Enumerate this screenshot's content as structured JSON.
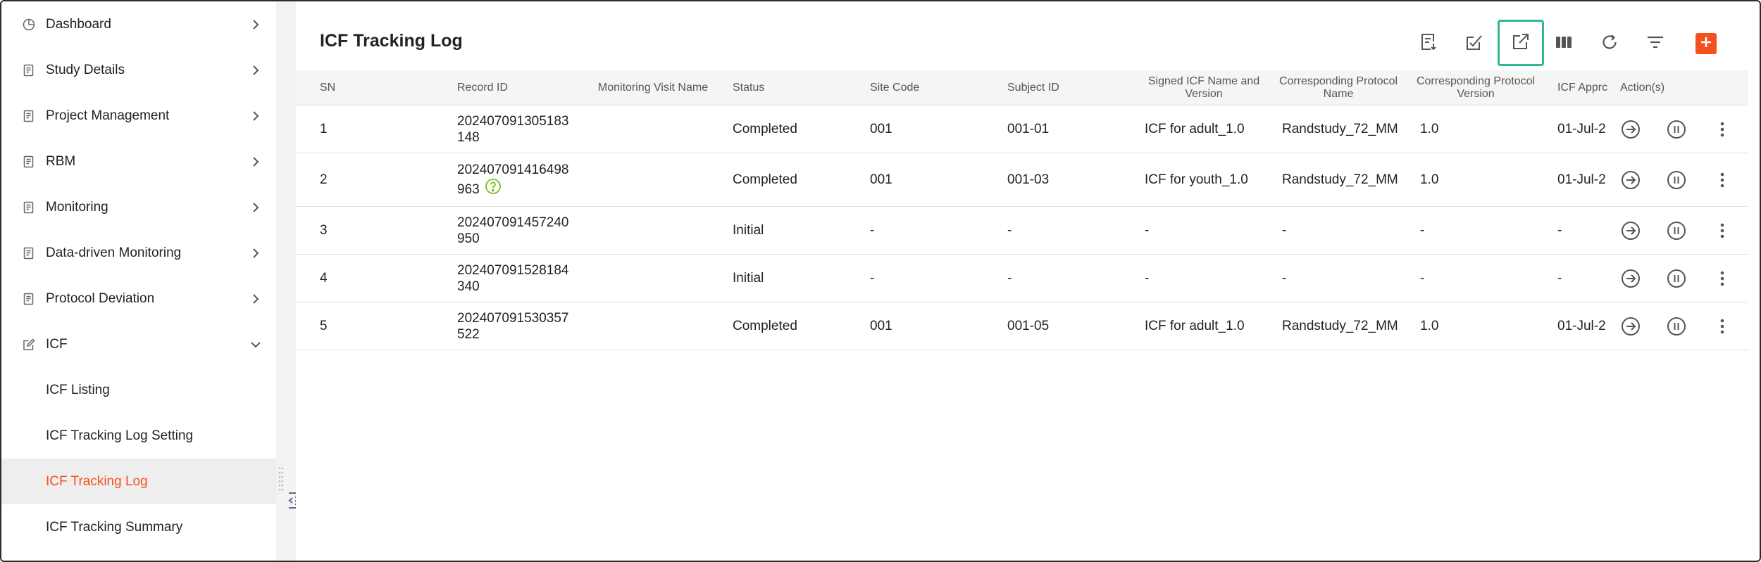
{
  "sidebar": {
    "items": [
      {
        "label": "Dashboard",
        "icon": "dashboard-icon"
      },
      {
        "label": "Study Details",
        "icon": "document-icon"
      },
      {
        "label": "Project Management",
        "icon": "document-icon"
      },
      {
        "label": "RBM",
        "icon": "document-icon"
      },
      {
        "label": "Monitoring",
        "icon": "document-icon"
      },
      {
        "label": "Data-driven Monitoring",
        "icon": "document-icon"
      },
      {
        "label": "Protocol Deviation",
        "icon": "document-icon"
      },
      {
        "label": "ICF",
        "icon": "edit-icon",
        "expanded": true
      }
    ],
    "sub_items": [
      {
        "label": "ICF Listing",
        "active": false
      },
      {
        "label": "ICF Tracking Log Setting",
        "active": false
      },
      {
        "label": "ICF Tracking Log",
        "active": true
      },
      {
        "label": "ICF Tracking Summary",
        "active": false
      }
    ]
  },
  "page": {
    "title": "ICF Tracking Log"
  },
  "toolbar": {
    "buttons": [
      "export-list-icon",
      "edit-check-icon",
      "open-external-icon",
      "columns-icon",
      "refresh-icon",
      "filter-icon",
      "add-icon"
    ],
    "highlighted": "open-external-icon"
  },
  "table": {
    "headers": {
      "sn": "SN",
      "record_id": "Record ID",
      "monitoring_visit_name": "Monitoring Visit Name",
      "status": "Status",
      "site_code": "Site Code",
      "subject_id": "Subject ID",
      "signed_icf": "Signed ICF Name and Version",
      "protocol_name": "Corresponding Protocol Name",
      "protocol_version": "Corresponding Protocol Version",
      "icf_approval": "ICF Apprc",
      "actions": "Action(s)"
    },
    "rows": [
      {
        "sn": "1",
        "record_id": "202407091305183 148",
        "monitoring_visit_name": "",
        "status": "Completed",
        "site_code": "001",
        "subject_id": "001-01",
        "signed_icf": "ICF for adult_1.0",
        "protocol_name": "Randstudy_72_MM",
        "protocol_version": "1.0",
        "icf_approval": "01-Jul-2",
        "has_help": false
      },
      {
        "sn": "2",
        "record_id": "202407091416498 963",
        "monitoring_visit_name": "",
        "status": "Completed",
        "site_code": "001",
        "subject_id": "001-03",
        "signed_icf": "ICF for youth_1.0",
        "protocol_name": "Randstudy_72_MM",
        "protocol_version": "1.0",
        "icf_approval": "01-Jul-2",
        "has_help": true
      },
      {
        "sn": "3",
        "record_id": "202407091457240 950",
        "monitoring_visit_name": "",
        "status": "Initial",
        "site_code": "-",
        "subject_id": "-",
        "signed_icf": "-",
        "protocol_name": "-",
        "protocol_version": "-",
        "icf_approval": "-",
        "has_help": false
      },
      {
        "sn": "4",
        "record_id": "202407091528184 340",
        "monitoring_visit_name": "",
        "status": "Initial",
        "site_code": "-",
        "subject_id": "-",
        "signed_icf": "-",
        "protocol_name": "-",
        "protocol_version": "-",
        "icf_approval": "-",
        "has_help": false
      },
      {
        "sn": "5",
        "record_id": "202407091530357 522",
        "monitoring_visit_name": "",
        "status": "Completed",
        "site_code": "001",
        "subject_id": "001-05",
        "signed_icf": "ICF for adult_1.0",
        "protocol_name": "Randstudy_72_MM",
        "protocol_version": "1.0",
        "icf_approval": "01-Jul-2",
        "has_help": false
      }
    ]
  },
  "colors": {
    "accent": "#f4511e",
    "highlight_border": "#33b59a",
    "help_icon": "#7cc21b",
    "icon_gray": "#666666"
  }
}
